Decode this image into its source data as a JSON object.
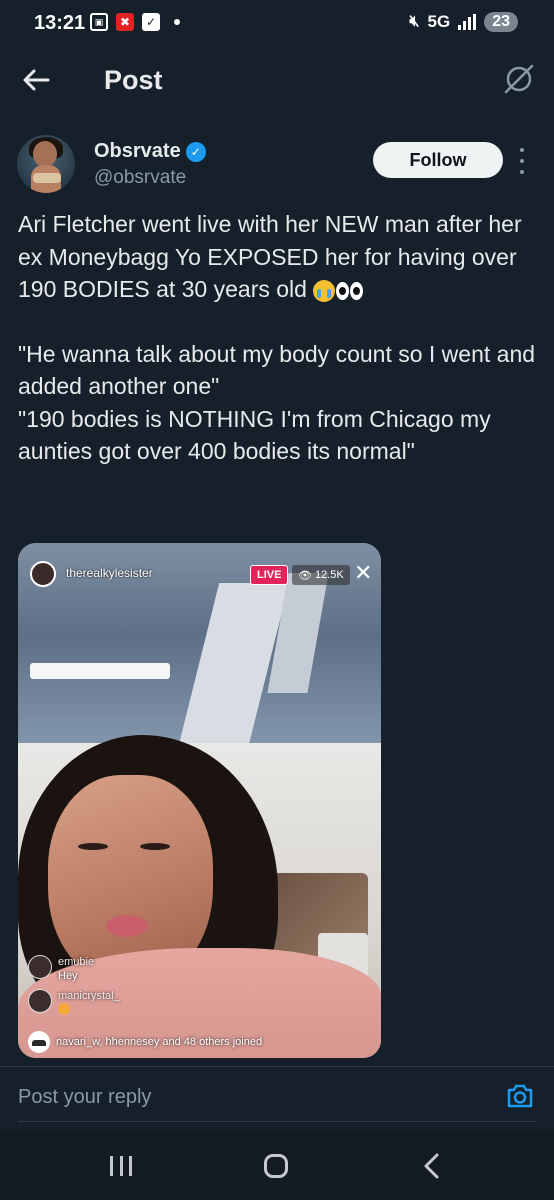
{
  "status_bar": {
    "time": "13:21",
    "network": "5G",
    "battery": "23"
  },
  "header": {
    "title": "Post"
  },
  "author": {
    "name": "Obsrvate",
    "handle": "@obsrvate",
    "follow_label": "Follow"
  },
  "post": {
    "paragraph1": "Ari Fletcher went live with her NEW man after her ex Moneybagg Yo EXPOSED her for having over 190 BODIES at 30 years old",
    "paragraph2": "\"He wanna talk about my body count so I went and added another one\"",
    "paragraph3": "\"190 bodies is NOTHING I'm from Chicago my aunties got over 400 bodies its normal\"",
    "emoji_names": [
      "loudly-crying-face-emoji",
      "eyes-emoji"
    ]
  },
  "media": {
    "live_username": "therealkylesister",
    "live_badge": "LIVE",
    "viewer_count": "12.5K",
    "comments": [
      {
        "name": "emubie",
        "text": "Hey"
      },
      {
        "name": "manicrystal_",
        "text": ""
      }
    ],
    "joined_text": "navari_w, hhennesey and 48 others joined"
  },
  "reply": {
    "placeholder": "Post your reply"
  },
  "colors": {
    "background": "#15202b",
    "accent": "#1d9bf0",
    "live_red": "#e2245a",
    "secondary_text": "#8b98a5"
  }
}
